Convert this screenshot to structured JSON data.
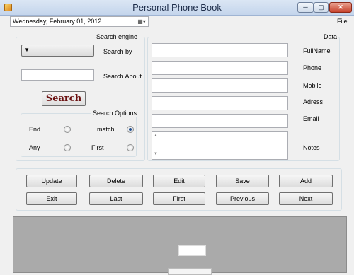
{
  "window": {
    "title": "Personal Phone Book",
    "controls": {
      "minimize": "─",
      "maximize": "▢",
      "close": "✕"
    }
  },
  "toolbar": {
    "date_value": "Wednesday,  February  01, 2012",
    "date_dropdown_glyph": "▦▾",
    "menu_file": "File"
  },
  "search_engine": {
    "title": "Search engine",
    "search_by_label": "Search by",
    "search_by_value": "",
    "dropdown_glyph": "▼",
    "search_about_label": "Search About",
    "search_about_value": "",
    "search_button": "Search"
  },
  "search_options": {
    "title": "Search Options",
    "options": [
      {
        "label": "End",
        "checked": false
      },
      {
        "label": "match",
        "checked": true
      },
      {
        "label": "Any",
        "checked": false
      },
      {
        "label": "First",
        "checked": false
      }
    ]
  },
  "data": {
    "title": "Data",
    "fields": [
      {
        "label": "FullName",
        "value": ""
      },
      {
        "label": "Phone",
        "value": ""
      },
      {
        "label": "Mobile",
        "value": ""
      },
      {
        "label": "Adress",
        "value": ""
      },
      {
        "label": "Email",
        "value": ""
      }
    ],
    "notes_label": "Notes",
    "notes_value": "",
    "scroll_up_glyph": "▲",
    "scroll_down_glyph": "▼"
  },
  "actions": {
    "row1": [
      "Update",
      "Delete",
      "Edit",
      "Save",
      "Add"
    ],
    "row2": [
      "Exit",
      "Last",
      "First",
      "Previous",
      "Next"
    ]
  },
  "colors": {
    "title_bar": "#c4d5ec",
    "close_button": "#c7432d",
    "search_button_text": "#6b1010",
    "bottom_panel": "#aaaaaa"
  }
}
